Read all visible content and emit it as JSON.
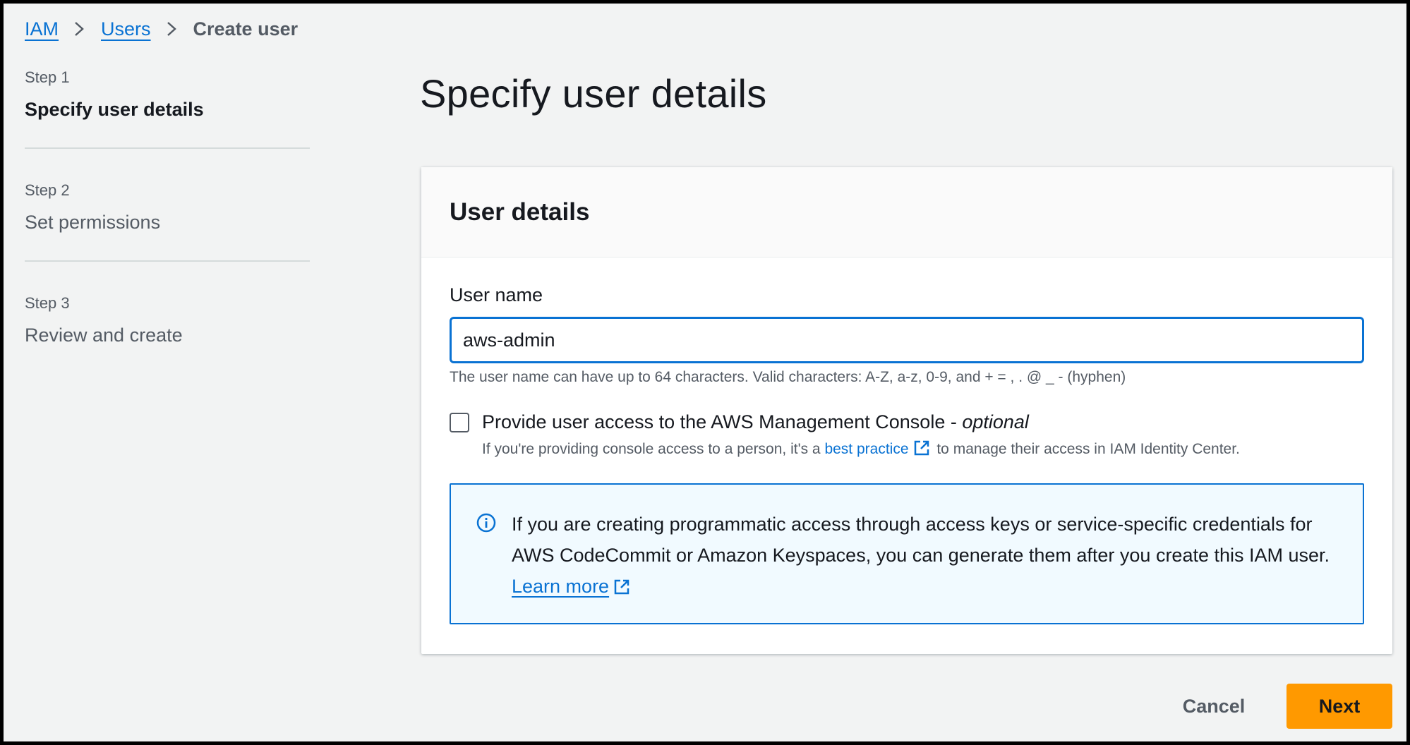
{
  "breadcrumb": {
    "items": [
      {
        "label": "IAM"
      },
      {
        "label": "Users"
      },
      {
        "label": "Create user"
      }
    ]
  },
  "steps": [
    {
      "number": "Step 1",
      "title": "Specify user details"
    },
    {
      "number": "Step 2",
      "title": "Set permissions"
    },
    {
      "number": "Step 3",
      "title": "Review and create"
    }
  ],
  "active_step": 1,
  "page_title": "Specify user details",
  "card": {
    "title": "User details",
    "user_name_label": "User name",
    "user_name_value": "aws-admin",
    "constraint_text": "The user name can have up to 64 characters. Valid characters: A-Z, a-z, 0-9, and + = , . @ _ - (hyphen)",
    "console_access": {
      "checked": false,
      "label": "Provide user access to the AWS Management Console - ",
      "optional": "optional",
      "desc_before": "If you're providing console access to a person, it's a ",
      "desc_link": "best practice",
      "desc_after": " to manage their access in IAM Identity Center."
    },
    "info": {
      "text": "If you are creating programmatic access through access keys or service-specific credentials for AWS CodeCommit or Amazon Keyspaces, you can generate them after you create this IAM user. ",
      "link": "Learn more"
    }
  },
  "actions": {
    "cancel": "Cancel",
    "next": "Next"
  },
  "colors": {
    "accent": "#0972d3",
    "primary_button": "#ff9900",
    "background": "#f2f3f3"
  }
}
